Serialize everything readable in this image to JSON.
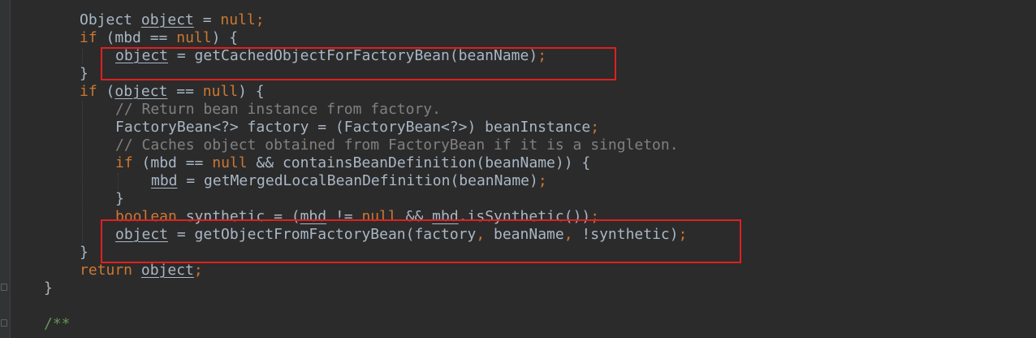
{
  "code": {
    "l1_type": "Object ",
    "l1_var": "object",
    "l1_eq": " = ",
    "l1_null": "null",
    "l1_semi": ";",
    "l2_if": "if",
    "l2_open": " (mbd == ",
    "l2_null": "null",
    "l2_close": ") {",
    "l3_var": "object",
    "l3_rest": " = getCachedObjectForFactoryBean(beanName)",
    "l3_semi": ";",
    "l4_brace": "}",
    "l5_if": "if",
    "l5_open": " (",
    "l5_var": "object",
    "l5_mid": " == ",
    "l5_null": "null",
    "l5_close": ") {",
    "l6_comment": "// Return bean instance from factory.",
    "l7_text": "FactoryBean<?> factory = (FactoryBean<?>) beanInstance",
    "l7_semi": ";",
    "l8_comment": "// Caches object obtained from FactoryBean if it is a singleton.",
    "l9_if": "if",
    "l9_open": " (mbd == ",
    "l9_null": "null",
    "l9_rest": " && containsBeanDefinition(beanName)) {",
    "l10_var": "mbd",
    "l10_rest": " = getMergedLocalBeanDefinition(beanName)",
    "l10_semi": ";",
    "l11_brace": "}",
    "l12_kw": "boolean",
    "l12_a": " synthetic = (",
    "l12_var1": "mbd",
    "l12_b": " != ",
    "l12_null": "null",
    "l12_c": " && ",
    "l12_var2": "mbd",
    "l12_d": ".isSynthetic())",
    "l12_semi": ";",
    "l13_var": "object",
    "l13_a": " = getObjectFromFactoryBean(factory",
    "l13_comma1": ",",
    "l13_b": " beanName",
    "l13_comma2": ",",
    "l13_c": " !synthetic)",
    "l13_semi": ";",
    "l14_brace": "}",
    "l15_ret": "return",
    "l15_sp": " ",
    "l15_var": "object",
    "l15_semi": ";",
    "l16_brace": "}",
    "l18_doc": "/**"
  },
  "colors": {
    "background": "#2b2b2b",
    "keyword": "#cc7832",
    "identifier": "#a9b7c6",
    "comment": "#808080",
    "doc_comment": "#629755",
    "highlight_box": "#e11f1f"
  }
}
